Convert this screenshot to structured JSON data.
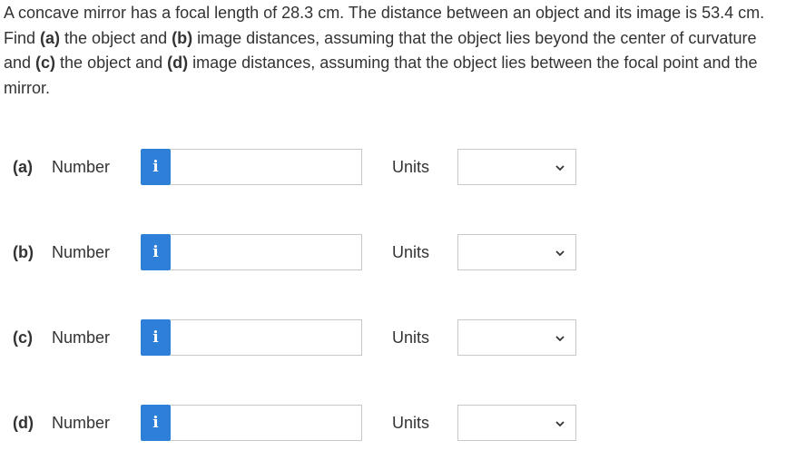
{
  "question": {
    "text_1": "A concave mirror has a focal length of 28.3 cm. The distance between an object and its image is 53.4 cm. Find ",
    "part_a": "(a)",
    "text_2": " the object and ",
    "part_b": "(b)",
    "text_3": " image distances, assuming that the object lies beyond the center of curvature and ",
    "part_c": "(c)",
    "text_4": " the object and ",
    "part_d": "(d)",
    "text_5": " image distances, assuming that the object lies between the focal point and the mirror."
  },
  "rows": [
    {
      "label": "(a)",
      "number_label": "Number",
      "info_icon": "i",
      "value": "",
      "units_label": "Units",
      "units_value": ""
    },
    {
      "label": "(b)",
      "number_label": "Number",
      "info_icon": "i",
      "value": "",
      "units_label": "Units",
      "units_value": ""
    },
    {
      "label": "(c)",
      "number_label": "Number",
      "info_icon": "i",
      "value": "",
      "units_label": "Units",
      "units_value": ""
    },
    {
      "label": "(d)",
      "number_label": "Number",
      "info_icon": "i",
      "value": "",
      "units_label": "Units",
      "units_value": ""
    }
  ],
  "colors": {
    "info_button": "#2d7fd8",
    "text": "#333333",
    "border": "#c8c8c8"
  },
  "icons": {
    "info": "info-icon",
    "dropdown": "chevron-down-icon"
  }
}
